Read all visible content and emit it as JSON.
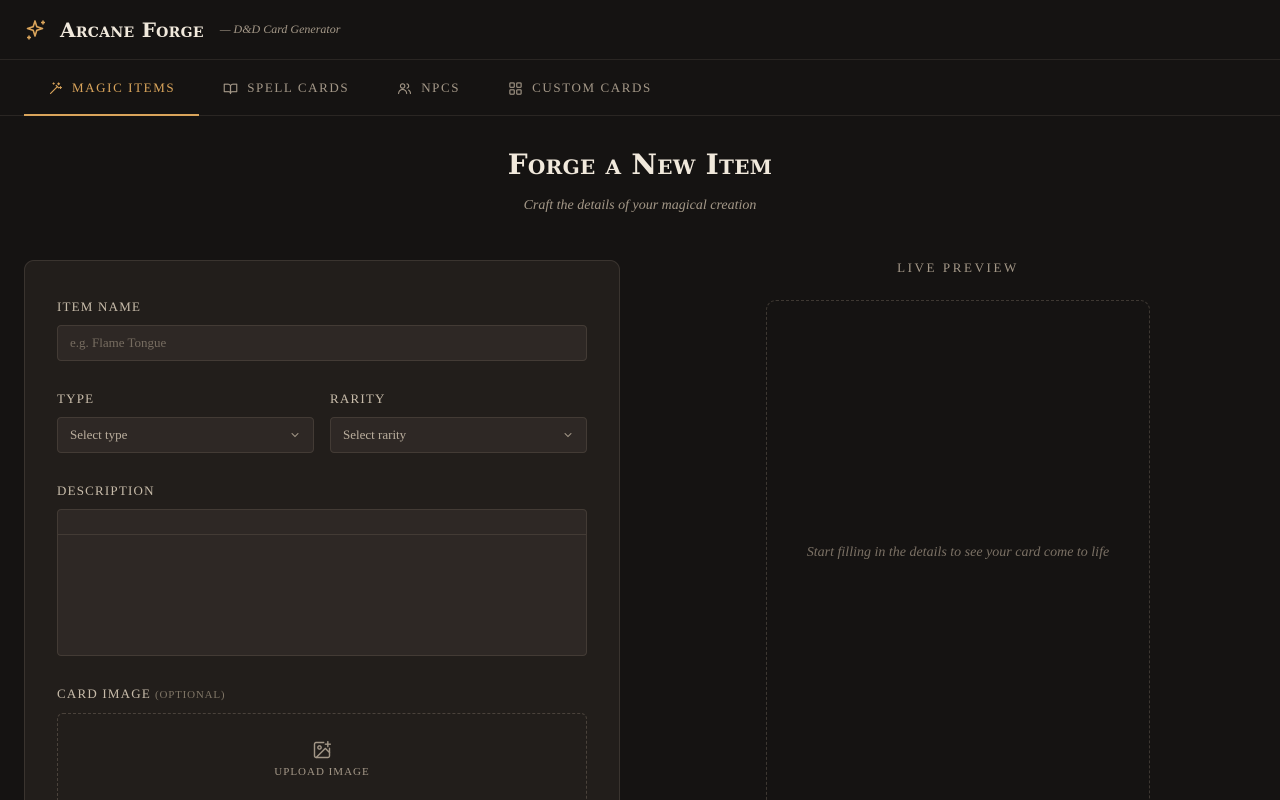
{
  "app": {
    "title": "Arcane Forge",
    "tagline": "— D&D Card Generator"
  },
  "colors": {
    "accent": "#d9a45b",
    "background": "#151312",
    "panel": "#221e1b"
  },
  "tabs": [
    {
      "label": "MAGIC ITEMS",
      "icon": "wand-sparkles-icon",
      "active": true
    },
    {
      "label": "SPELL CARDS",
      "icon": "book-open-icon",
      "active": false
    },
    {
      "label": "NPCS",
      "icon": "users-icon",
      "active": false
    },
    {
      "label": "CUSTOM CARDS",
      "icon": "grid-icon",
      "active": false
    }
  ],
  "hero": {
    "title": "Forge a New Item",
    "subtitle": "Craft the details of your magical creation"
  },
  "form": {
    "item_name": {
      "label": "ITEM NAME",
      "placeholder": "e.g. Flame Tongue",
      "value": ""
    },
    "type": {
      "label": "TYPE",
      "value": "Select type"
    },
    "rarity": {
      "label": "RARITY",
      "value": "Select rarity"
    },
    "description": {
      "label": "DESCRIPTION",
      "value": ""
    },
    "card_image": {
      "label": "CARD IMAGE",
      "optional": "(OPTIONAL)",
      "upload_label": "UPLOAD IMAGE"
    }
  },
  "preview": {
    "title": "LIVE PREVIEW",
    "empty_text": "Start filling in the details to see your card come to life"
  }
}
